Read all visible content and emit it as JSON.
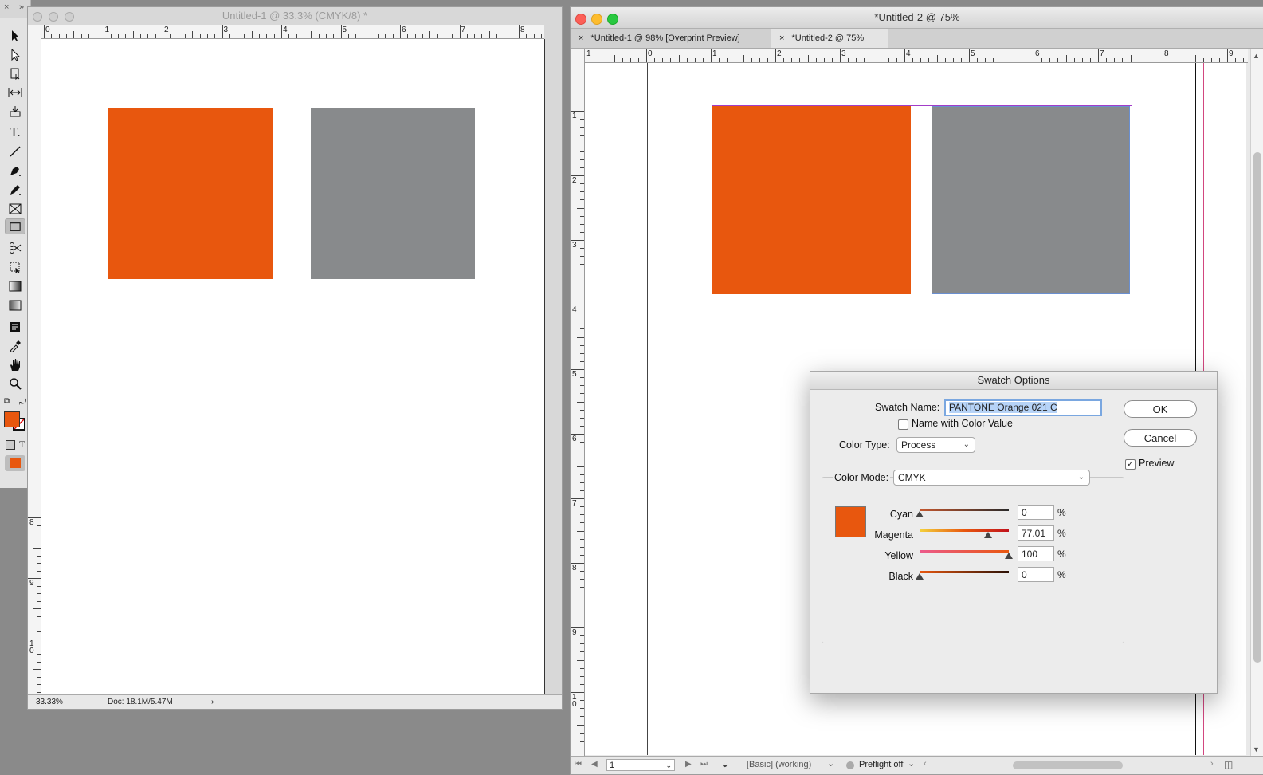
{
  "toolbox": {
    "tools": [
      "selection-tool",
      "direct-selection-tool",
      "page-tool",
      "gap-tool",
      "content-collector-tool",
      "type-tool",
      "line-tool",
      "pen-tool",
      "pencil-tool",
      "rectangle-frame-tool",
      "rectangle-tool",
      "scissors-tool",
      "free-transform-tool",
      "gradient-swatch-tool",
      "gradient-feather-tool",
      "note-tool",
      "eyedropper-tool",
      "hand-tool",
      "zoom-tool"
    ],
    "fill_color": "#e8570e",
    "text_label": "T"
  },
  "doc1": {
    "title": "Untitled-1 @ 33.3% (CMYK/8) *",
    "ruler_labels": [
      "0",
      "1",
      "2",
      "3",
      "4",
      "5",
      "6",
      "7",
      "8"
    ],
    "vruler_labels": [
      "8",
      "9",
      "1\n0"
    ],
    "zoom": "33.33%",
    "doc_info": "Doc: 18.1M/5.47M",
    "arrow": "›",
    "rect_colors": [
      "#e8570e",
      "#888a8c"
    ]
  },
  "doc2": {
    "title": "*Untitled-2 @ 75%",
    "tabs": [
      {
        "close": "×",
        "label": "*Untitled-1 @ 98% [Overprint Preview]"
      },
      {
        "close": "×",
        "label": "*Untitled-2 @ 75%"
      }
    ],
    "ruler_labels": [
      "1",
      "0",
      "1",
      "2",
      "3",
      "4",
      "5",
      "6",
      "7",
      "8",
      "9"
    ],
    "vruler_labels": [
      "1",
      "2",
      "3",
      "4",
      "5",
      "6",
      "7",
      "8",
      "9",
      "1\n0"
    ],
    "page_number": "1",
    "style_preset": "[Basic] (working)",
    "preflight": "Preflight off",
    "rect_colors": [
      "#e8570e",
      "#888a8c"
    ]
  },
  "dialog": {
    "title": "Swatch Options",
    "swatch_name_label": "Swatch Name:",
    "swatch_name_value": "PANTONE Orange 021 C",
    "name_with_value_label": "Name with Color Value",
    "color_type_label": "Color Type:",
    "color_type_value": "Process",
    "color_mode_label": "Color Mode:",
    "color_mode_value": "CMYK",
    "ok_label": "OK",
    "cancel_label": "Cancel",
    "preview_label": "Preview",
    "preview_checked": "✓",
    "swatch_color": "#e8570e",
    "channels": [
      {
        "name": "Cyan",
        "value": "0",
        "level": 0
      },
      {
        "name": "Magenta",
        "value": "77.01",
        "level": 0.7701
      },
      {
        "name": "Yellow",
        "value": "100",
        "level": 1.0
      },
      {
        "name": "Black",
        "value": "0",
        "level": 0
      }
    ],
    "percent": "%"
  }
}
